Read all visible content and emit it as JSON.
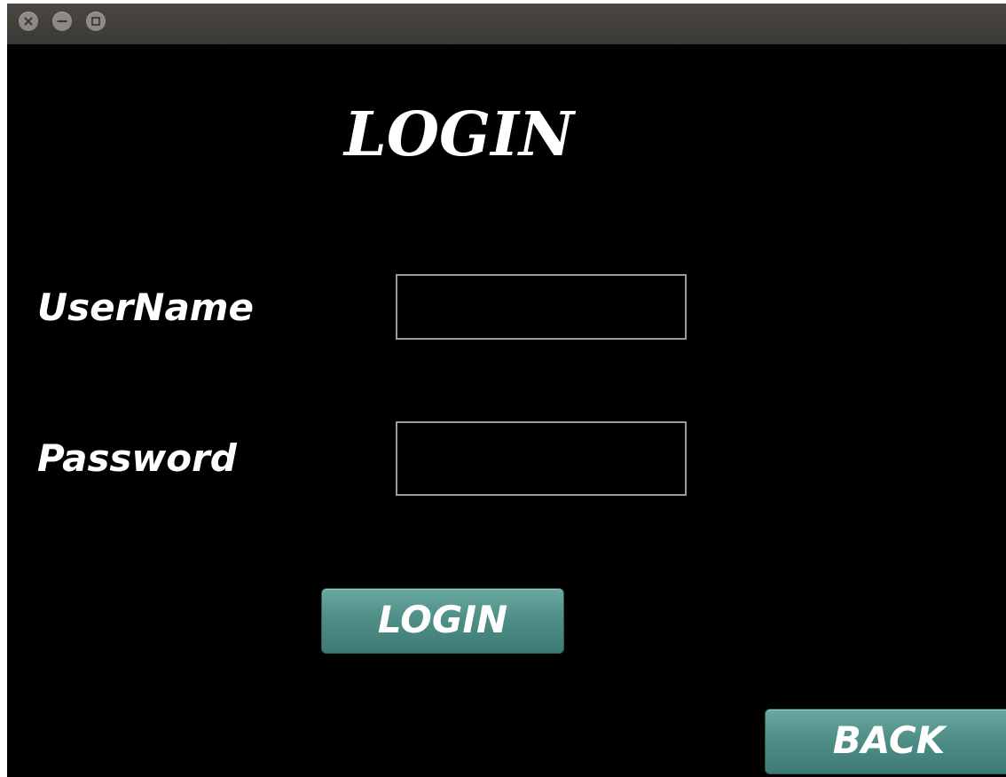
{
  "window": {
    "controls": {
      "close_icon": "close-icon",
      "minimize_icon": "minimize-icon",
      "maximize_icon": "maximize-icon"
    }
  },
  "form": {
    "heading": "LOGIN",
    "username_label": "UserName",
    "username_value": "",
    "password_label": "Password",
    "password_value": "",
    "login_button": "LOGIN",
    "back_button": "BACK"
  },
  "colors": {
    "background": "#000000",
    "titlebar": "#3d3b37",
    "button": "#4f8f88",
    "text": "#ffffff",
    "field_border": "#9a9a9a"
  }
}
